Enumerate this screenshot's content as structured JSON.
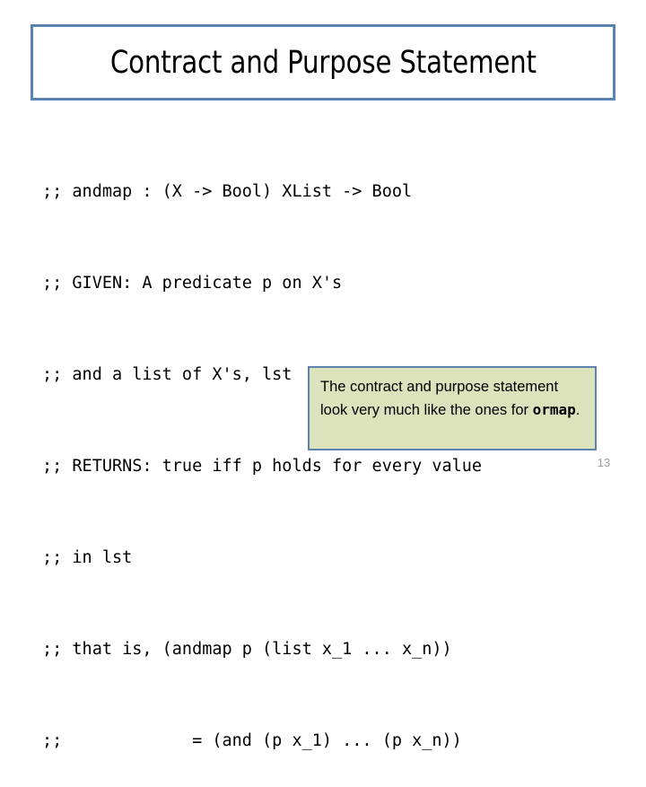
{
  "slide": {
    "title": "Contract and Purpose Statement",
    "page_number": "13",
    "colors": {
      "border": "#5B83B0",
      "callout_background": "#DCE2BC",
      "text": "#000000",
      "page_number": "#9A9A9A",
      "slide_background": "#FFFFFF"
    }
  },
  "code": {
    "language": "racket",
    "lines": [
      ";; andmap : (X -> Bool) XList -> Bool",
      ";; GIVEN: A predicate p on X's",
      ";; and a list of X's, lst",
      ";; RETURNS: true iff p holds for every value",
      ";; in lst",
      ";; that is, (andmap p (list x_1 ... x_n))",
      ";;             = (and (p x_1) ... (p x_n))"
    ]
  },
  "callout": {
    "text_before": "The contract and purpose statement look very much like the ones for ",
    "emphasis": "ormap",
    "text_after": "."
  }
}
